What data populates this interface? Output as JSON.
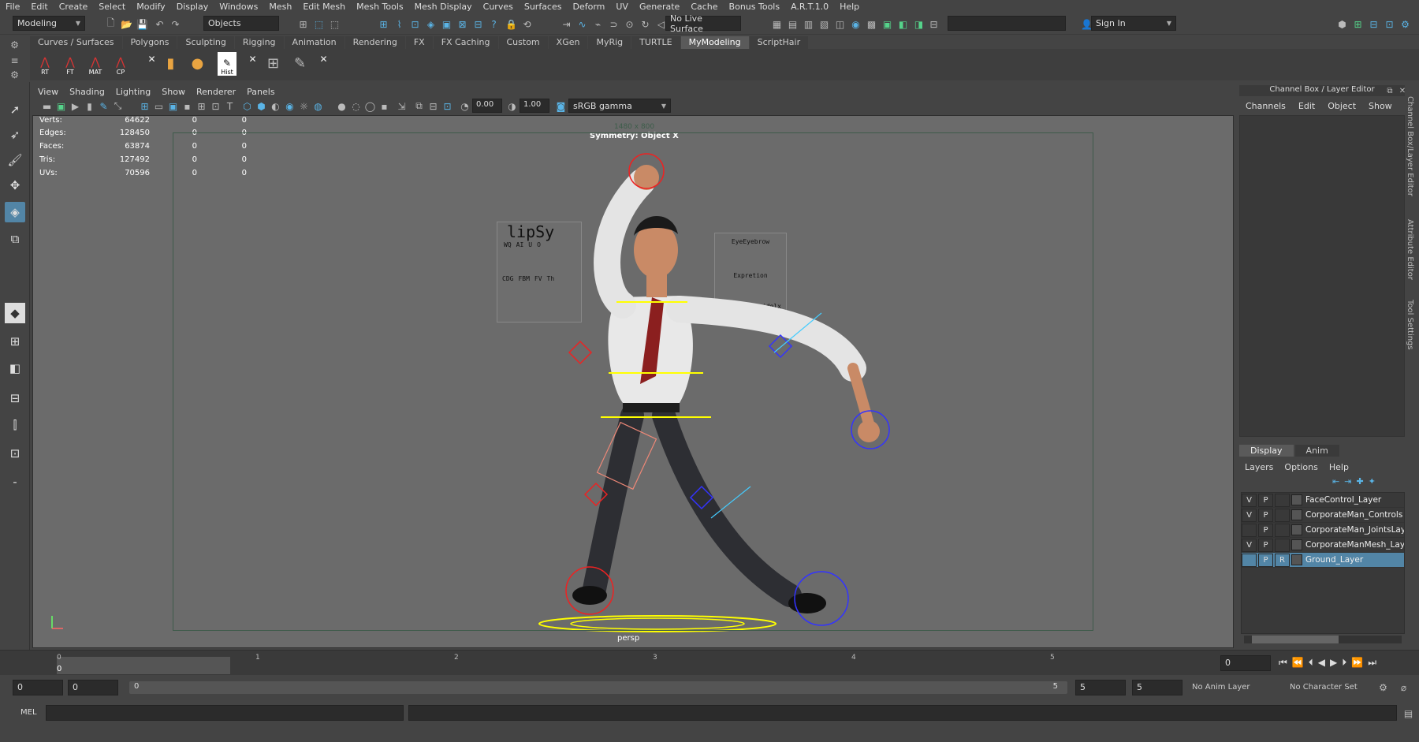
{
  "menubar": [
    "File",
    "Edit",
    "Create",
    "Select",
    "Modify",
    "Display",
    "Windows",
    "Mesh",
    "Edit Mesh",
    "Mesh Tools",
    "Mesh Display",
    "Curves",
    "Surfaces",
    "Deform",
    "UV",
    "Generate",
    "Cache",
    "Bonus Tools",
    "A.R.T.1.0",
    "Help"
  ],
  "status": {
    "mode": "Modeling",
    "objects": "Objects",
    "live_surface": "No Live Surface",
    "sign_in": "Sign In"
  },
  "shelf_tabs": [
    "Curves / Surfaces",
    "Polygons",
    "Sculpting",
    "Rigging",
    "Animation",
    "Rendering",
    "FX",
    "FX Caching",
    "Custom",
    "XGen",
    "MyRig",
    "TURTLE",
    "MyModeling",
    "ScriptHair"
  ],
  "shelf_active": "MyModeling",
  "shelf_icons": [
    "RT",
    "FT",
    "MAT",
    "CP",
    "Hist"
  ],
  "viewport": {
    "menus": [
      "View",
      "Shading",
      "Lighting",
      "Show",
      "Renderer",
      "Panels"
    ],
    "near": "0.00",
    "far": "1.00",
    "color_space": "sRGB gamma",
    "resolution": "1480 x 800",
    "symmetry": "Symmetry: Object X",
    "camera": "persp",
    "hud": [
      {
        "label": "Verts:",
        "value": "64622",
        "a": "0",
        "b": "0"
      },
      {
        "label": "Edges:",
        "value": "128450",
        "a": "0",
        "b": "0"
      },
      {
        "label": "Faces:",
        "value": "63874",
        "a": "0",
        "b": "0"
      },
      {
        "label": "Tris:",
        "value": "127492",
        "a": "0",
        "b": "0"
      },
      {
        "label": "UVs:",
        "value": "70596",
        "a": "0",
        "b": "0"
      }
    ],
    "panel_lipsync": {
      "title": "lipSy",
      "row1": [
        "WQ",
        "AI",
        "U",
        "O"
      ],
      "row2": [
        "CDG",
        "FBM",
        "FV",
        "Th"
      ]
    },
    "panel_brow": {
      "title": "EyeEyebrow",
      "sub": "Expretion",
      "label": "idelx"
    }
  },
  "channel_box": {
    "title": "Channel Box / Layer Editor",
    "menus": [
      "Channels",
      "Edit",
      "Object",
      "Show"
    ]
  },
  "layer_editor": {
    "tabs": [
      "Display",
      "Anim"
    ],
    "active_tab": "Display",
    "menus": [
      "Layers",
      "Options",
      "Help"
    ],
    "layers": [
      {
        "v": "V",
        "p": "P",
        "name": "FaceControl_Layer",
        "selected": false
      },
      {
        "v": "V",
        "p": "P",
        "name": "CorporateMan_Controls",
        "selected": false
      },
      {
        "v": "",
        "p": "P",
        "name": "CorporateMan_JointsLay",
        "selected": false
      },
      {
        "v": "V",
        "p": "P",
        "name": "CorporateManMesh_Lay",
        "selected": false
      },
      {
        "v": "",
        "p": "P",
        "name": "Ground_Layer",
        "r": "R",
        "selected": true
      }
    ]
  },
  "side_tabs": [
    "Channel Box/Layer Editor",
    "Attribute Editor",
    "Tool Settings"
  ],
  "timeline": {
    "ticks": [
      "0",
      "1",
      "2",
      "3",
      "4",
      "5"
    ],
    "current": "0",
    "current_time_field": "0"
  },
  "range": {
    "start": "0",
    "playback_start": "0",
    "slider_start": "0",
    "slider_end": "5",
    "playback_end": "5",
    "end": "5",
    "anim_layer": "No Anim Layer",
    "char_set": "No Character Set"
  },
  "command_line": {
    "label": "MEL"
  }
}
